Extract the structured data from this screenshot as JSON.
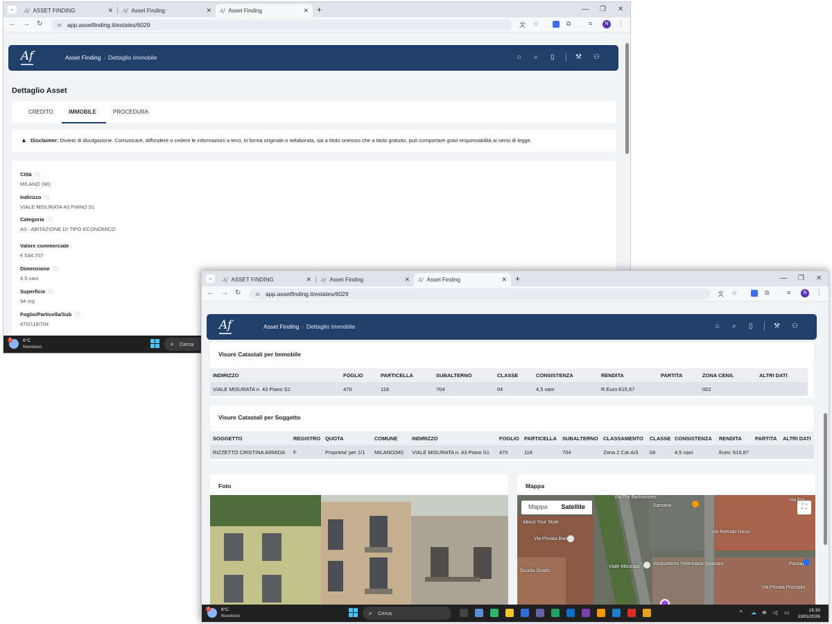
{
  "browser": {
    "tabs": [
      {
        "label": "ASSET FINDING"
      },
      {
        "label": "Asset Finding"
      },
      {
        "label": "Asset Finding"
      }
    ],
    "url": "app.assetfinding.it/estates/6029"
  },
  "app": {
    "logo": "Af",
    "breadcrumb": [
      "Asset Finding",
      "Dettaglio Immobile"
    ]
  },
  "page": {
    "title": "Dettaglio Asset",
    "tabs": [
      "CREDITO",
      "IMMOBILE",
      "PROCEDURA"
    ],
    "active_tab": "IMMOBILE",
    "disclaimer_label": "Disclaimer:",
    "disclaimer_text": "Divieto di divulgazione. Comunicare, diffondere o cedere le informazioni a terzi, in forma originale o rielaborata, sia a titolo oneroso che a titolo gratuito, può comportare gravi responsabilità ai sensi di legge."
  },
  "details": {
    "citta_label": "Città",
    "citta": "MILANO (MI)",
    "indirizzo_label": "Indirizzo",
    "indirizzo": "VIALE MISURATA 43 PIANO S1",
    "categoria_label": "Categoria",
    "categoria": "A3 - ABITAZIONE DI TIPO ECONOMICO",
    "valore_label": "Valore commerciale",
    "valore": "€ 534.707",
    "dimensione_label": "Dimensione",
    "dimensione": "4.5 vani",
    "superficie_label": "Superficie",
    "superficie": "94 mq",
    "foglio_label": "Foglio/Particella/Sub",
    "foglio": "470/118/704"
  },
  "visure_immobile": {
    "title": "Visure Catastali per Immobile",
    "headers": [
      "INDIRIZZO",
      "FOGLIO",
      "PARTICELLA",
      "SUBALTERNO",
      "CLASSE",
      "CONSISTENZA",
      "RENDITA",
      "PARTITA",
      "ZONA CENS.",
      "ALTRI DATI"
    ],
    "row": [
      "VIALE MISURATA n. 43 Piano S1",
      "470",
      "118",
      "704",
      "04",
      "4,5 vani",
      "R.Euro:615,87",
      "",
      "002",
      ""
    ]
  },
  "visure_soggetto": {
    "title": "Visure Catastali per Soggetto",
    "headers": [
      "SOGGETTO",
      "REGISTRO",
      "QUOTA",
      "COMUNE",
      "INDIRIZZO",
      "FOGLIO",
      "PARTICELLA",
      "SUBALTERNO",
      "CLASSAMENTO",
      "CLASSE",
      "CONSISTENZA",
      "RENDITA",
      "PARTITA",
      "ALTRI DATI"
    ],
    "row": [
      "RIZZETTO CRISTINA ARMIDA",
      "F",
      "Proprieta' per 1/1",
      "MILANO(MI)",
      "VIALE MISURATA n. 43 Piano S1",
      "470",
      "118",
      "704",
      "Zona 2 Cat.A/3",
      "04",
      "4,5 vani",
      "Euro: 615,87",
      "",
      ""
    ]
  },
  "foto": {
    "title": "Foto"
  },
  "mappa": {
    "title": "Mappa",
    "toggle": [
      "Mappa",
      "Satellite"
    ],
    "active": "Satellite",
    "labels": [
      "Via Fra Bartolomeo",
      "Via Fra",
      "Via Privata Barca",
      "Viale Misurata",
      "Via Romolo Gessi",
      "Ambulatorio Veterinario Spaziani",
      "Passapò",
      "Via Privata Procopio",
      "Scuola Grado",
      "About Your Style",
      "Samaria"
    ]
  },
  "taskbar": {
    "temp": "6°C",
    "weather": "Nuvoloso",
    "search": "Cerca",
    "time": "15:30",
    "date": "13/01/2026",
    "badge": "2"
  }
}
